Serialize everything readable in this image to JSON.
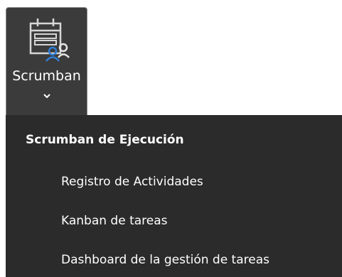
{
  "ribbon": {
    "button_label": "Scrumban",
    "icon": "calendar-people-icon",
    "chevron_icon": "chevron-down-icon"
  },
  "menu": {
    "header": "Scrumban de Ejecución",
    "items": [
      {
        "label": "Registro de Actividades"
      },
      {
        "label": "Kanban de tareas"
      },
      {
        "label": "Dashboard de la gestión de tareas"
      }
    ]
  },
  "colors": {
    "button_bg": "#3b3b3b",
    "menu_bg": "#2b2b2b",
    "accent_blue": "#2f7fd6",
    "text": "#ffffff"
  }
}
